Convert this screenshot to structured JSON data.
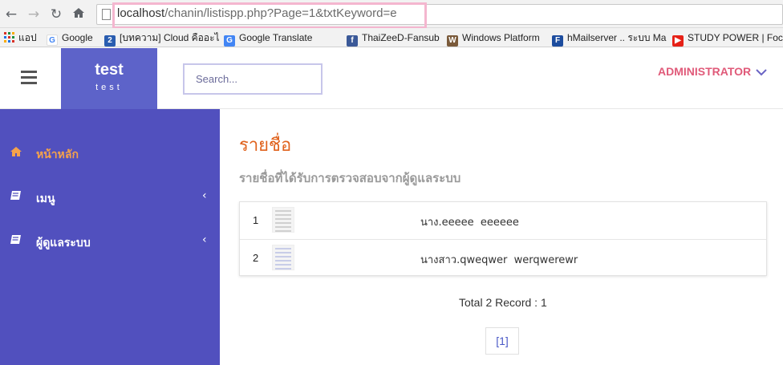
{
  "browser": {
    "url_host": "localhost",
    "url_path": "/chanin/listispp.php?Page=1&txtKeyword=e",
    "bookmarks": [
      {
        "label": "แอป",
        "icon": "apps-grid-icon"
      },
      {
        "label": "Google",
        "icon": "google-icon"
      },
      {
        "label": "[บทความ] Cloud คืออะไ",
        "icon": "bookmark-2-icon"
      },
      {
        "label": "Google Translate",
        "icon": "translate-icon"
      },
      {
        "label": "ThaiZeeD-Fansub",
        "icon": "facebook-icon"
      },
      {
        "label": "Windows Platform",
        "icon": "windows-icon"
      },
      {
        "label": "hMailserver .. ระบบ Ma",
        "icon": "f-icon"
      },
      {
        "label": "STUDY POWER | Focu",
        "icon": "youtube-icon"
      }
    ]
  },
  "header": {
    "brand_title": "test",
    "brand_subtitle": "test",
    "search_placeholder": "Search...",
    "user_label": "ADMINISTRATOR"
  },
  "sidebar": {
    "items": [
      {
        "label": "หน้าหลัก",
        "icon": "home-icon",
        "active": true
      },
      {
        "label": "เมนู",
        "icon": "book-icon",
        "has_children": true
      },
      {
        "label": "ผู้ดูแลระบบ",
        "icon": "book-icon",
        "has_children": true
      }
    ]
  },
  "main": {
    "title": "รายชื่อ",
    "subtitle": "รายชื่อที่ได้รับการตรวจสอบจากผู้ดูแลระบบ",
    "rows": [
      {
        "num": "1",
        "name": "นาง.eeeee  eeeeee"
      },
      {
        "num": "2",
        "name": "นางสาว.qweqwer  werqwerewr"
      }
    ],
    "total": "Total 2 Record : 1",
    "page_label": "[1]"
  },
  "colors": {
    "sidebar_bg": "#5150be",
    "brand_bg": "#5d63c9",
    "title_orange": "#e0621d",
    "admin_pink": "#e05a79",
    "active_orange": "#f5a24b"
  }
}
